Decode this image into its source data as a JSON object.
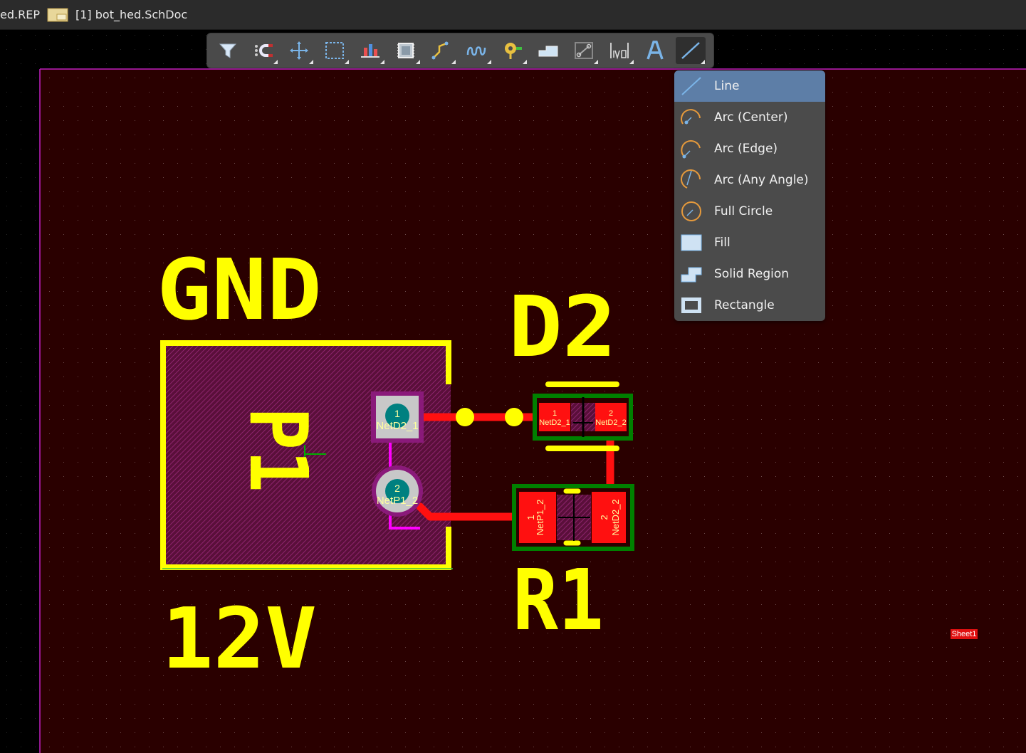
{
  "tabs": [
    {
      "label": "ed.REP"
    },
    {
      "label": "[1] bot_hed.SchDoc"
    }
  ],
  "toolbar": {
    "buttons": [
      {
        "icon": "filter-icon"
      },
      {
        "icon": "snap-magnet-icon"
      },
      {
        "icon": "move-crosshair-icon"
      },
      {
        "icon": "select-rect-icon"
      },
      {
        "icon": "align-chart-icon"
      },
      {
        "icon": "component-chip-icon"
      },
      {
        "icon": "route-track-icon"
      },
      {
        "icon": "interactive-tuning-icon"
      },
      {
        "icon": "via-pad-icon"
      },
      {
        "icon": "polygon-pour-icon"
      },
      {
        "icon": "keepout-icon"
      },
      {
        "icon": "dimension-icon"
      },
      {
        "icon": "string-text-icon"
      },
      {
        "icon": "line-icon"
      }
    ]
  },
  "dropdown": {
    "items": [
      {
        "label": "Line",
        "icon": "line-icon",
        "selected": true
      },
      {
        "label": "Arc (Center)",
        "icon": "arc-center-icon"
      },
      {
        "label": "Arc (Edge)",
        "icon": "arc-edge-icon"
      },
      {
        "label": "Arc (Any Angle)",
        "icon": "arc-any-angle-icon"
      },
      {
        "label": "Full Circle",
        "icon": "full-circle-icon"
      },
      {
        "label": "Fill",
        "icon": "fill-icon"
      },
      {
        "label": "Solid Region",
        "icon": "solid-region-icon"
      },
      {
        "label": "Rectangle",
        "icon": "rectangle-icon"
      }
    ]
  },
  "pcb": {
    "labels": {
      "gnd": "GND",
      "v12": "12V",
      "p1": "P1",
      "d2": "D2",
      "r1": "R1"
    },
    "pads": {
      "p1_pad1_num": "1",
      "p1_pad1_net": "NetD2_1",
      "p1_pad2_num": "2",
      "p1_pad2_net": "NetP1_2",
      "d2_pad1_num": "1",
      "d2_pad1_net": "NetD2_1",
      "d2_pad2_num": "2",
      "d2_pad2_net": "NetD2_2",
      "r1_pad1_num": "1",
      "r1_pad1_net": "NetP1_2",
      "r1_pad2_num": "2",
      "r1_pad2_net": "NetD2_2"
    },
    "sheet_tag": "Sheet1"
  },
  "colors": {
    "board": "#2a0000",
    "silkscreen": "#ffff00",
    "track": "#ff1010",
    "overlay": "#ff00ff",
    "pad_green": "#008000",
    "teal": "#008080",
    "menu_selected": "#5d7ea7",
    "icon_blue": "#5aa0e0",
    "icon_orange": "#e69a3c"
  }
}
